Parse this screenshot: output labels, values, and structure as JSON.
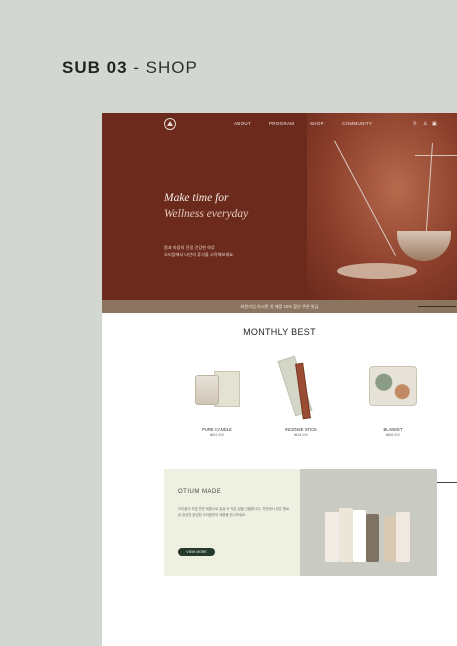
{
  "heading": {
    "strong": "SUB 03",
    "separator": " - ",
    "light": "SHOP"
  },
  "nav": {
    "items": [
      "ABOUT",
      "PROGRAM",
      "SHOP",
      "COMMUNITY"
    ],
    "icons": [
      "search-icon",
      "user-icon",
      "cart-icon"
    ]
  },
  "hero": {
    "title_line1": "Make time for",
    "title_line2": "Wellness everyday",
    "desc_line1": "몸과 마음의 진정 건강한 하루",
    "desc_line2": "오티움에서 나만의 휴식을 시작해보세요."
  },
  "promo": {
    "text": "회원가입 하시면 첫 제품 10% 할인 쿠폰 발급"
  },
  "best": {
    "title": "MONTHLY BEST",
    "products": [
      {
        "name": "PURE CANDLE",
        "price": "₩34,000"
      },
      {
        "name": "INCENSE STICK",
        "price": "₩18,000"
      },
      {
        "name": "BLANKET",
        "price": "₩58,000"
      }
    ]
  },
  "otium": {
    "title": "OTIUM MADE",
    "desc": "오티움이 직접 만든 제품으로 일상 속 작은 쉼을 선물합니다. 자연에서 얻은 원료로 정성껏 완성한 오티움만의 제품을 만나보세요.",
    "button": "VIEW MORE"
  },
  "colors": {
    "hero": "#6b2a1c",
    "promo": "#8b7561",
    "button": "#263a2c",
    "background": "#d2d8d1"
  }
}
